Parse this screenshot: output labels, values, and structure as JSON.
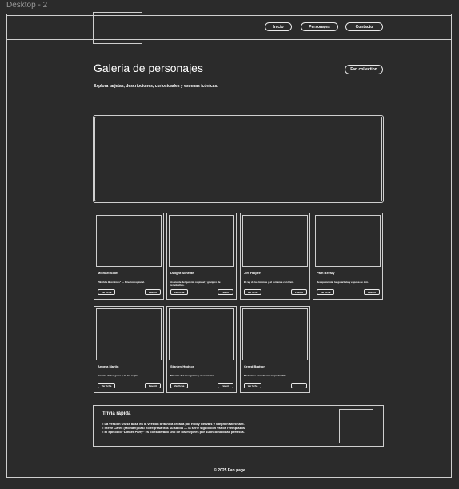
{
  "canvas": {
    "label": "Desktop - 2"
  },
  "nav": {
    "items": [
      "Inicio",
      "Personajes",
      "Contacto"
    ]
  },
  "header": {
    "title": "Galeria de personajes",
    "subtitle": "Explora tarjetas, descripciones, curiosidades y escenas icónicas.",
    "fan_button": "Fan collection"
  },
  "cards": [
    {
      "name": "Michael Scott",
      "desc": "\"World's Best Boss\" — Director regional.",
      "btn1": "Ver ficha",
      "btn2": "Favorit"
    },
    {
      "name": "Dwight Schrute",
      "desc": "Asistente del gerente regional y granjero de remolachas.",
      "btn1": "Ver ficha",
      "btn2": "Favorit"
    },
    {
      "name": "Jim Halpert",
      "desc": "El rey de las bromas y el romance con Pam.",
      "btn1": "Ver ficha",
      "btn2": "Favorit"
    },
    {
      "name": "Pam Beesly",
      "desc": "Recepcionista, luego artista y esposa de Jim.",
      "btn1": "Ver ficha",
      "btn2": "Favorit"
    },
    {
      "name": "Angela Martin",
      "desc": "Amante de los gatos y de las reglas.",
      "btn1": "Ver ficha",
      "btn2": "Favorit"
    },
    {
      "name": "Stanley Hudson",
      "desc": "Maestro del crucigrama y el sarcasmo.",
      "btn1": "Ver ficha",
      "btn2": "Favorit"
    },
    {
      "name": "Creed Bratton",
      "desc": "Misterioso y totalmente impredecible.",
      "btn1": "Ver ficha",
      "btn2": ""
    }
  ],
  "trivia": {
    "title": "Trivia rápida",
    "items": [
      "La versión US se basa en la versión británica creada por Ricky Gervais y Stephen Merchant.",
      "Steve Carell (Michael) casi no regresa tras su salida — la serie siguió con varios reemplazos.",
      "El episodio \"Dinner Party\" es considerado uno de los mejores por su incomodidad perfecta."
    ]
  },
  "footer": {
    "text": "© 2025 Fan page"
  }
}
